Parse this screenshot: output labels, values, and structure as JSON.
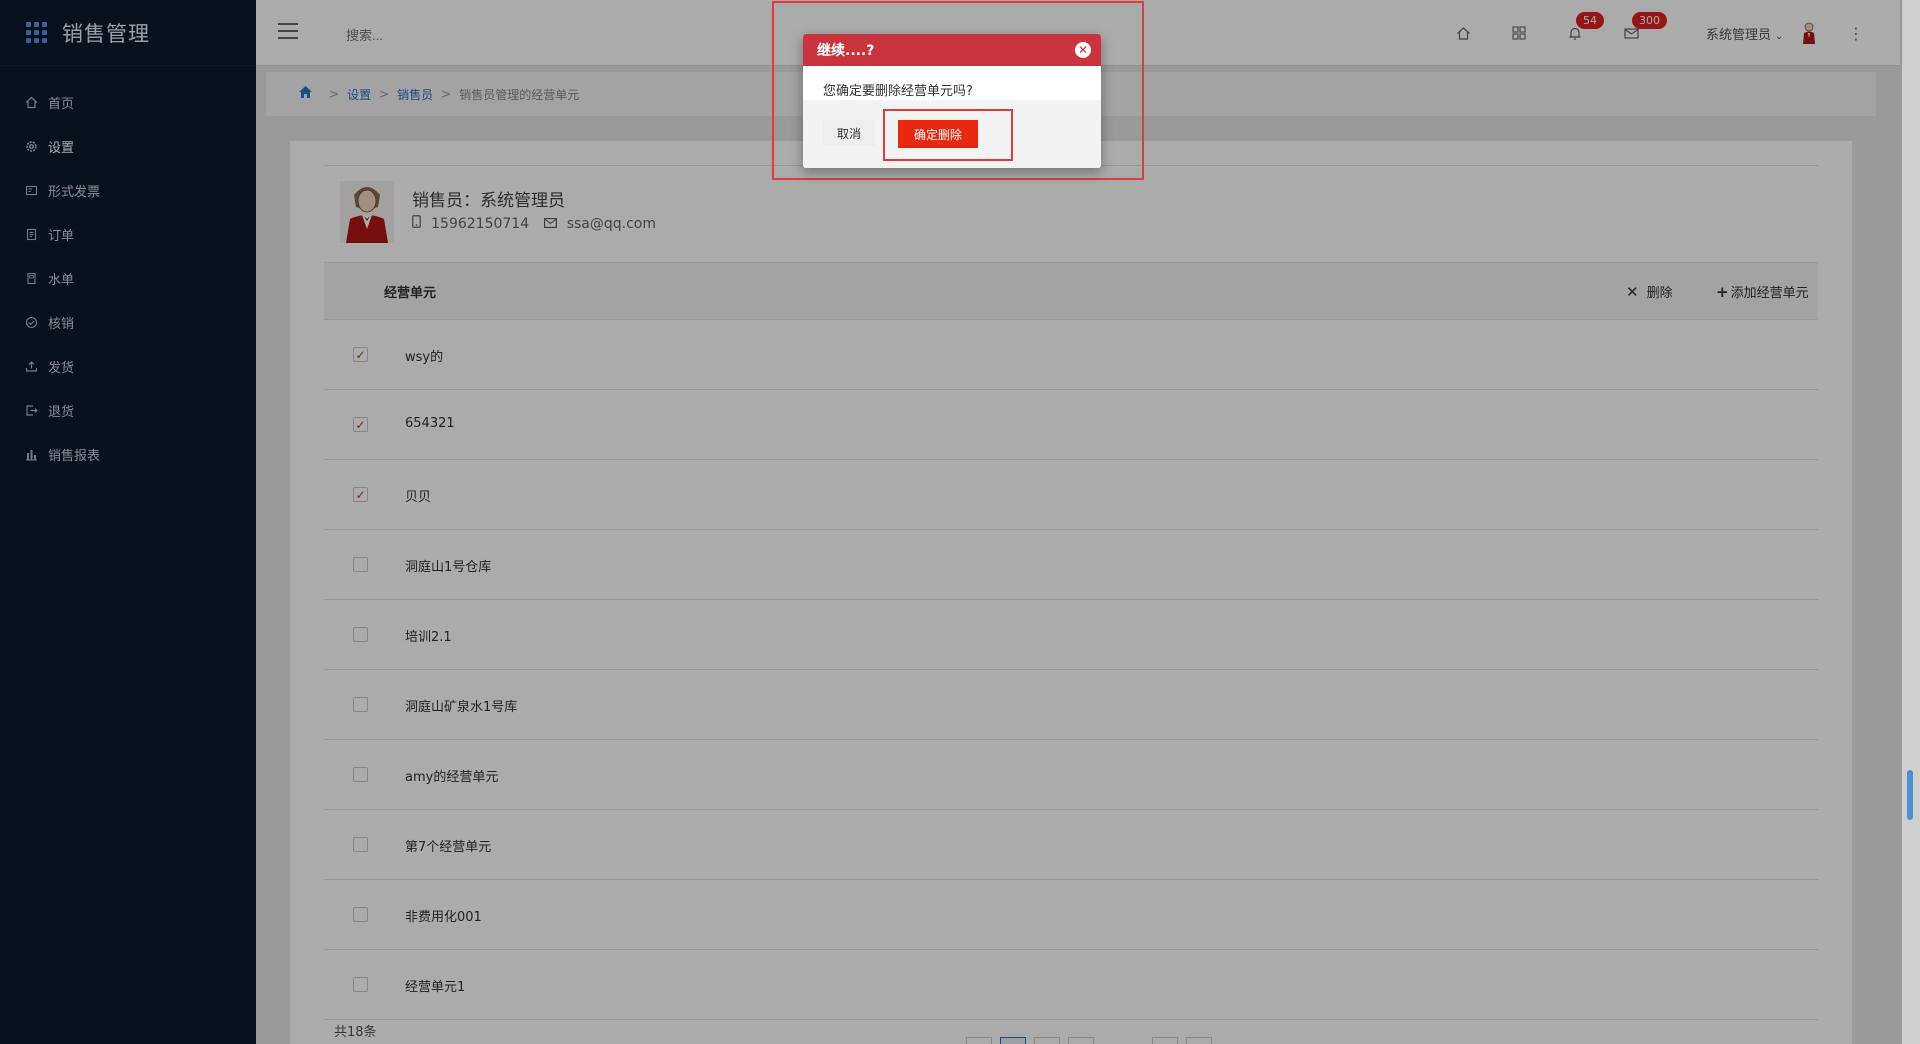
{
  "app": {
    "title": "销售管理"
  },
  "sidebar": {
    "items": [
      {
        "label": "首页",
        "icon": "home-icon"
      },
      {
        "label": "设置",
        "icon": "gear-icon"
      },
      {
        "label": "形式发票",
        "icon": "invoice-icon"
      },
      {
        "label": "订单",
        "icon": "order-icon"
      },
      {
        "label": "水单",
        "icon": "receipt-icon"
      },
      {
        "label": "核销",
        "icon": "check-circle-icon"
      },
      {
        "label": "发货",
        "icon": "upload-icon"
      },
      {
        "label": "退货",
        "icon": "return-icon"
      },
      {
        "label": "销售报表",
        "icon": "bar-chart-icon"
      }
    ],
    "active_index": 1
  },
  "header": {
    "search_placeholder": "搜索...",
    "notifications_count": "54",
    "messages_count": "300",
    "user_name": "系统管理员"
  },
  "breadcrumb": {
    "items": [
      "设置",
      "销售员"
    ],
    "current": "销售员管理的经营单元"
  },
  "profile": {
    "name_label": "销售员：系统管理员",
    "phone": "15962150714",
    "email": "ssa@qq.com"
  },
  "table": {
    "title": "经营单元",
    "delete_label": "删除",
    "add_label": "添加经营单元",
    "rows": [
      {
        "label": "wsy的",
        "checked": true
      },
      {
        "label": "654321",
        "checked": true
      },
      {
        "label": "贝贝",
        "checked": true
      },
      {
        "label": "洞庭山1号仓库",
        "checked": false
      },
      {
        "label": "培训2.1",
        "checked": false
      },
      {
        "label": "洞庭山矿泉水1号库",
        "checked": false
      },
      {
        "label": "amy的经营单元",
        "checked": false
      },
      {
        "label": "第7个经营单元",
        "checked": false
      },
      {
        "label": "非费用化001",
        "checked": false
      },
      {
        "label": "经营单元1",
        "checked": false
      }
    ],
    "total_label": "共18条"
  },
  "dialog": {
    "title": "继续....?",
    "message": "您确定要删除经营单元吗?",
    "cancel_label": "取消",
    "confirm_label": "确定删除"
  },
  "colors": {
    "sidebar_bg": "#0b1a2c",
    "dialog_header": "#c9343f",
    "confirm_button": "#e8290f",
    "highlight_border": "#e23b3b",
    "link": "#2a73c7"
  }
}
